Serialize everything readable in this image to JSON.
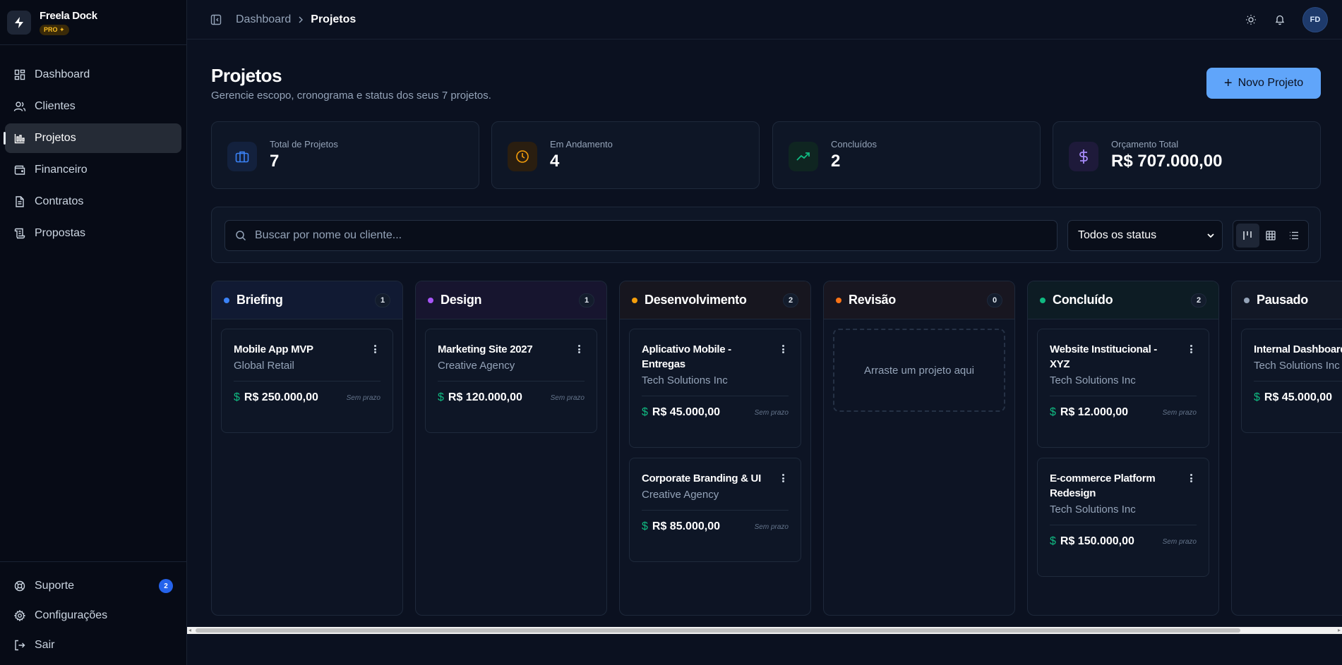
{
  "brand": {
    "name": "Freela Dock",
    "badge": "PRO ✦"
  },
  "nav": {
    "items": [
      {
        "label": "Dashboard"
      },
      {
        "label": "Clientes"
      },
      {
        "label": "Projetos"
      },
      {
        "label": "Financeiro"
      },
      {
        "label": "Contratos"
      },
      {
        "label": "Propostas"
      }
    ],
    "active": "Projetos",
    "bottom": [
      {
        "label": "Suporte",
        "badge": "2"
      },
      {
        "label": "Configurações"
      },
      {
        "label": "Sair"
      }
    ]
  },
  "header": {
    "breadcrumb_root": "Dashboard",
    "breadcrumb_current": "Projetos",
    "avatar_initials": "FD"
  },
  "page": {
    "title": "Projetos",
    "subtitle": "Gerencie escopo, cronograma e status dos seus 7 projetos.",
    "new_button": "Novo Projeto"
  },
  "stats": [
    {
      "label": "Total de Projetos",
      "value": "7",
      "icon": "briefcase-icon",
      "color": "#3b82f6"
    },
    {
      "label": "Em Andamento",
      "value": "4",
      "icon": "clock-icon",
      "color": "#f59e0b"
    },
    {
      "label": "Concluídos",
      "value": "2",
      "icon": "trending-up-icon",
      "color": "#10b981"
    },
    {
      "label": "Orçamento Total",
      "value": "R$ 707.000,00",
      "icon": "dollar-icon",
      "color": "#a78bfa"
    }
  ],
  "filters": {
    "search_placeholder": "Buscar por nome ou cliente...",
    "status_selected": "Todos os status",
    "views": [
      "kanban-view-icon",
      "grid-view-icon",
      "list-view-icon"
    ],
    "active_view": "kanban-view-icon"
  },
  "columns": [
    {
      "title": "Briefing",
      "count": "1",
      "color": "#3b82f6",
      "cards": [
        {
          "title": "Mobile App MVP",
          "client": "Global Retail",
          "value": "R$ 250.000,00",
          "due": "Sem prazo"
        }
      ]
    },
    {
      "title": "Design",
      "count": "1",
      "color": "#a855f7",
      "cards": [
        {
          "title": "Marketing Site 2027",
          "client": "Creative Agency",
          "value": "R$ 120.000,00",
          "due": "Sem prazo"
        }
      ]
    },
    {
      "title": "Desenvolvimento",
      "count": "2",
      "color": "#f59e0b",
      "cards": [
        {
          "title": "Aplicativo Mobile - Entregas",
          "client": "Tech Solutions Inc",
          "value": "R$ 45.000,00",
          "due": "Sem prazo"
        },
        {
          "title": "Corporate Branding & UI",
          "client": "Creative Agency",
          "value": "R$ 85.000,00",
          "due": "Sem prazo"
        }
      ]
    },
    {
      "title": "Revisão",
      "count": "0",
      "color": "#f97316",
      "empty_text": "Arraste um projeto aqui",
      "cards": []
    },
    {
      "title": "Concluído",
      "count": "2",
      "color": "#10b981",
      "cards": [
        {
          "title": "Website Institucional - XYZ",
          "client": "Tech Solutions Inc",
          "value": "R$ 12.000,00",
          "due": "Sem prazo"
        },
        {
          "title": "E-commerce Platform Redesign",
          "client": "Tech Solutions Inc",
          "value": "R$ 150.000,00",
          "due": "Sem prazo"
        }
      ]
    },
    {
      "title": "Pausado",
      "count": "",
      "color": "#94a3b8",
      "cards": [
        {
          "title": "Internal Dashboard",
          "client": "Tech Solutions Inc",
          "value": "R$ 45.000,00",
          "due": ""
        }
      ]
    }
  ]
}
